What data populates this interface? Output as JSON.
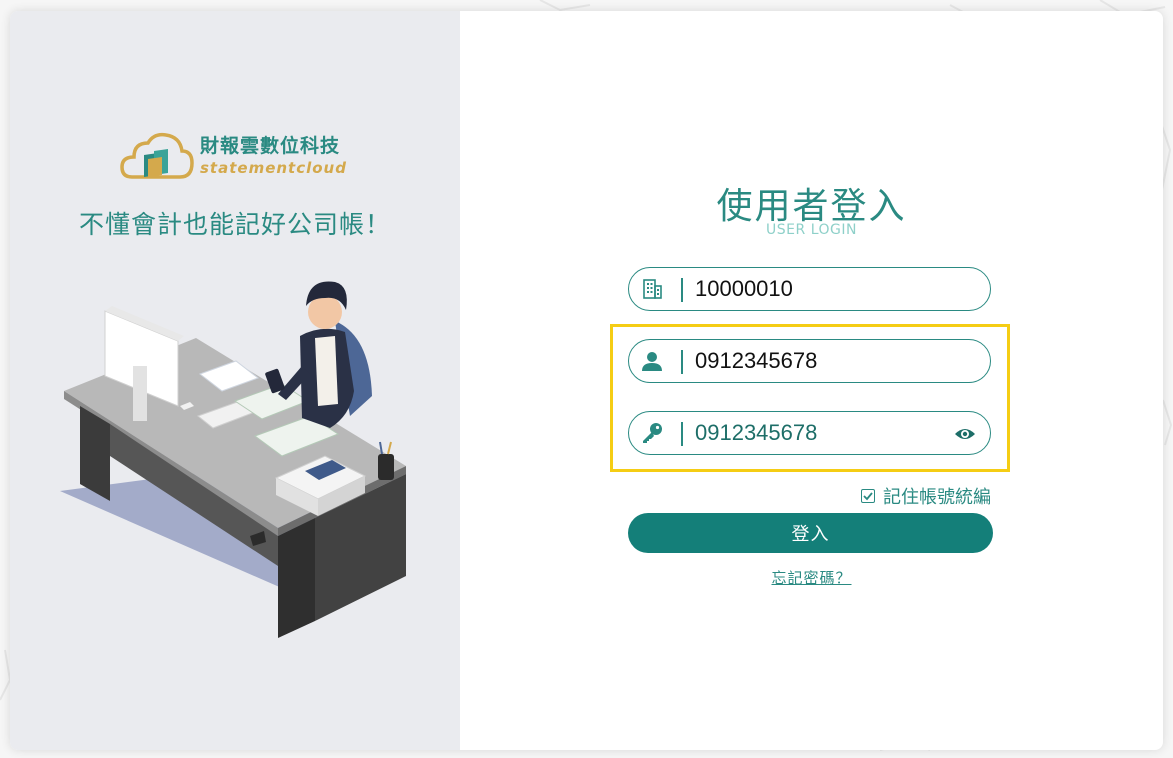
{
  "brand": {
    "name": "財報雲數位科技",
    "sub": "statementcloud",
    "tagline": "不懂會計也能記好公司帳！",
    "colors": {
      "primary": "#147f79",
      "accent": "#d4a94c",
      "highlight": "#f5cd14"
    }
  },
  "login": {
    "title": "使用者登入",
    "subtitle": "USER LOGIN",
    "company_field": {
      "icon": "building-icon",
      "value": "10000010"
    },
    "user_field": {
      "icon": "user-icon",
      "value": "0912345678"
    },
    "password_field": {
      "icon": "key-icon",
      "value": "0912345678",
      "toggle_icon": "eye-icon"
    },
    "remember": {
      "label": "記住帳號統編",
      "checked": true
    },
    "submit_label": "登入",
    "forgot_label": "忘記密碼？"
  }
}
